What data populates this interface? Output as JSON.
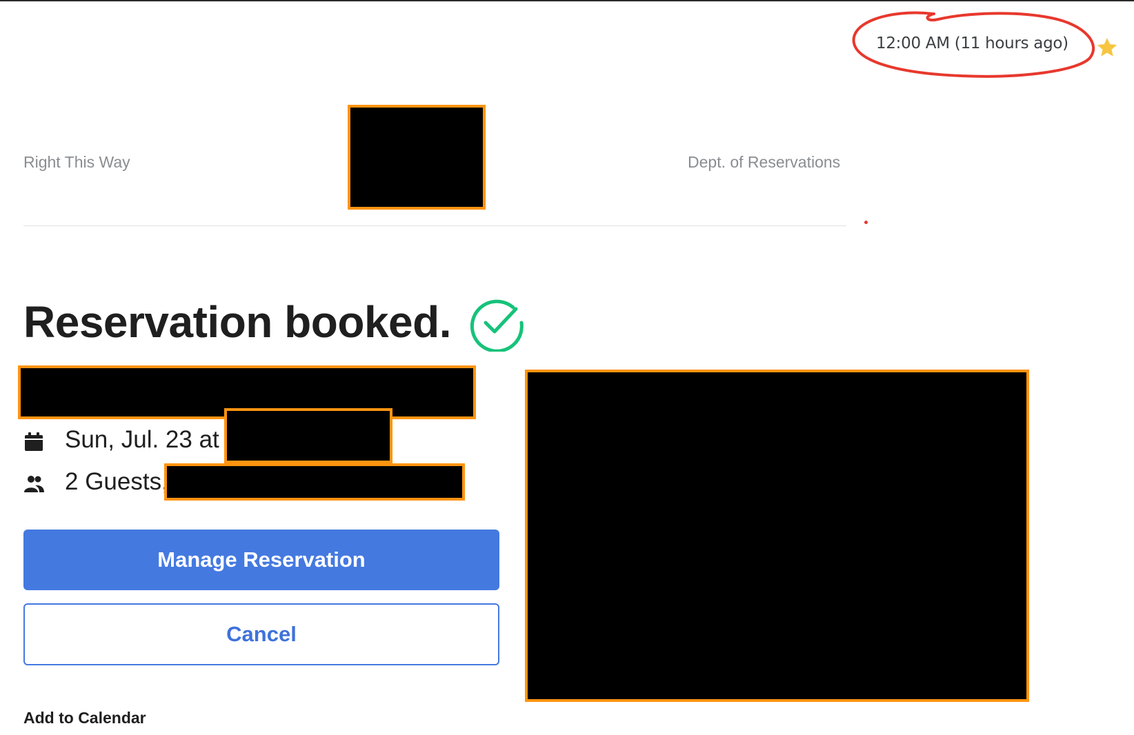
{
  "email": {
    "timestamp": "12:00 AM (11 hours ago)",
    "star_icon": "star-icon",
    "annotation_color": "#e8382d"
  },
  "header": {
    "brand_left": "Right This Way",
    "brand_right": "Dept. of Reservations"
  },
  "confirmation": {
    "title": "Reservation booked.",
    "title_icon": "check-circle-icon",
    "accent_color": "#17c27a"
  },
  "details": {
    "date_icon": "calendar-icon",
    "date_text": "Sun, Jul. 23 at",
    "guests_icon": "guests-icon",
    "guests_text": "2 Guests,"
  },
  "actions": {
    "manage_label": "Manage Reservation",
    "cancel_label": "Cancel",
    "add_to_calendar_label": "Add to Calendar",
    "primary_color": "#4479e0"
  },
  "redaction_color": "#ff9410"
}
